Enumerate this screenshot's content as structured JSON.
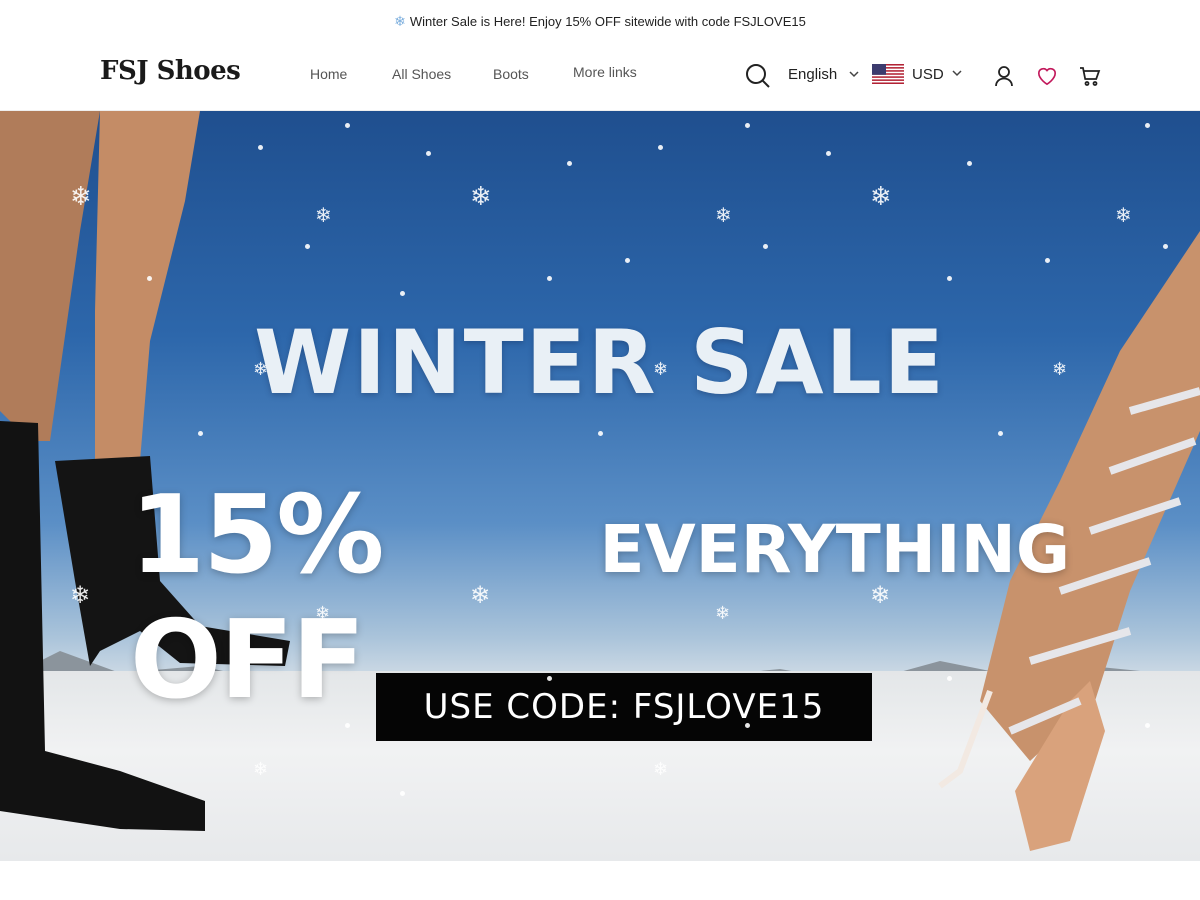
{
  "announcement": {
    "icon": "snowflake-icon",
    "text": "Winter Sale is Here! Enjoy 15% OFF sitewide with code FSJLOVE15"
  },
  "header": {
    "logo": "FSJ Shoes",
    "nav": [
      "Home",
      "All Shoes",
      "Boots",
      "More links"
    ],
    "language": "English",
    "currency": "USD",
    "icons": [
      "search-icon",
      "account-icon",
      "wishlist-heart-icon",
      "cart-icon"
    ],
    "accent_color": "#c2185b"
  },
  "hero": {
    "title": "WINTER SALE",
    "sub_big": "15% OFF",
    "sub_small": "EVERYTHING",
    "code": "USE CODE: FSJLOVE15"
  }
}
